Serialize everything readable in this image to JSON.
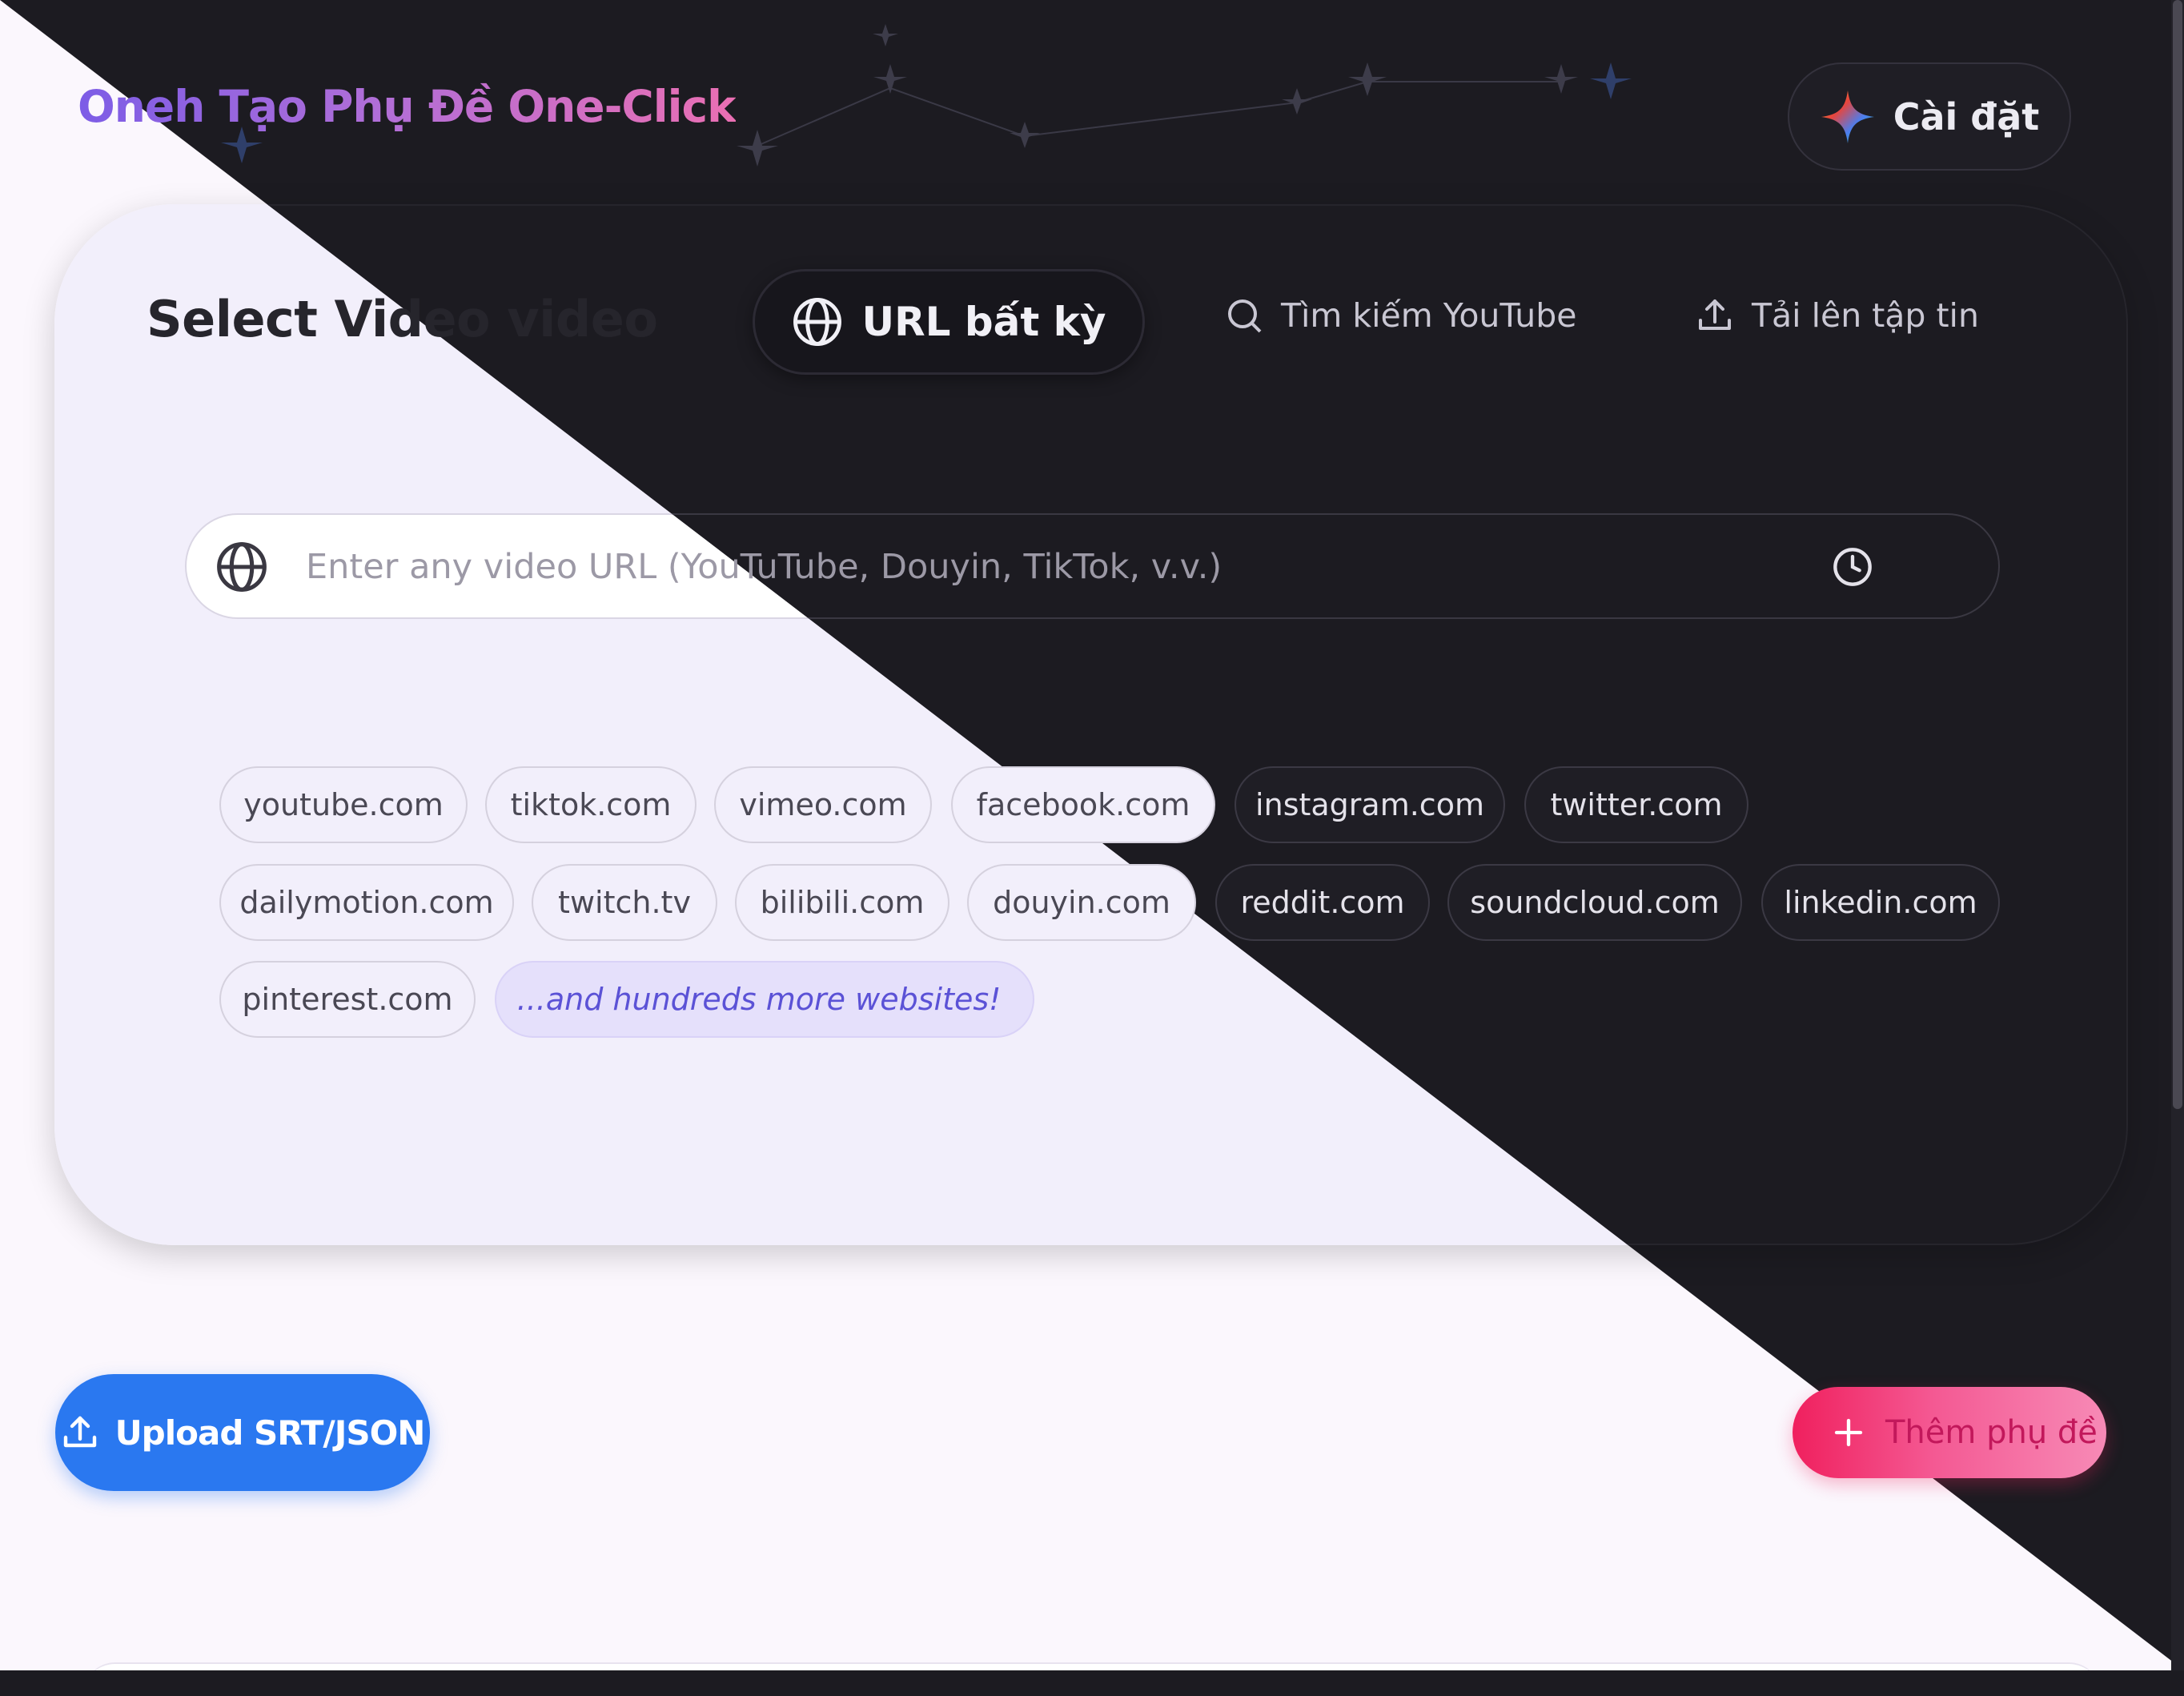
{
  "header": {
    "app_title": "Oneh Tạo Phụ Đề One-Click",
    "settings_label": "Cài đặt"
  },
  "panel": {
    "title": "Select Video video",
    "tabs": [
      {
        "label": "URL bất kỳ",
        "icon": "globe-icon",
        "active": true
      },
      {
        "label": "Tìm kiếm YouTube",
        "icon": "search-icon",
        "active": false
      },
      {
        "label": "Tải lên tập tin",
        "icon": "upload-icon",
        "active": false
      }
    ],
    "url_input": {
      "placeholder": "Enter any video URL (YouTuTube, Douyin, TikTok, v.v.)",
      "value": ""
    },
    "sites": [
      "youtube.com",
      "tiktok.com",
      "vimeo.com",
      "facebook.com",
      "instagram.com",
      "twitter.com",
      "dailymotion.com",
      "twitch.tv",
      "bilibili.com",
      "douyin.com",
      "reddit.com",
      "soundcloud.com",
      "linkedin.com",
      "pinterest.com"
    ],
    "more_sites_label": "...and hundreds more websites!"
  },
  "actions": {
    "upload_label": "Upload SRT/JSON",
    "add_subtitle_label": "Thêm phụ đề"
  },
  "colors": {
    "dark_bg": "#1c1b21",
    "light_bg": "#fbf7fd",
    "upload_blue": "#2a78f0",
    "add_pink": "#f0205e",
    "accent_purple": "#7c5ce6"
  }
}
